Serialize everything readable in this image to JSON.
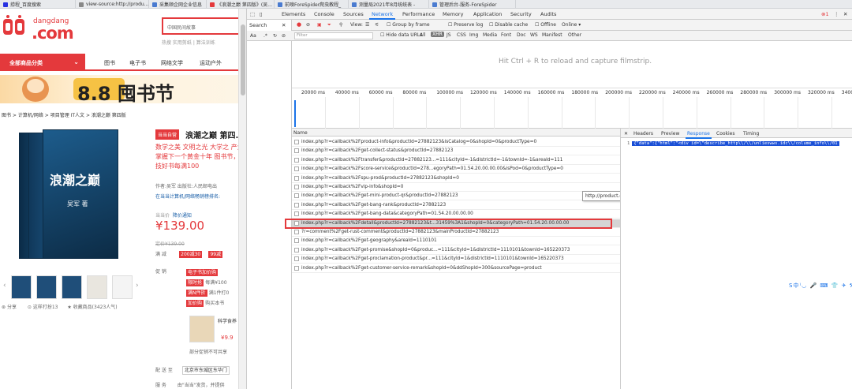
{
  "browser_tabs": [
    {
      "label": "捞程_百度搜索",
      "color": "#2932e1",
      "w": 96
    },
    {
      "label": "view-source:http://produ...",
      "color": "#888",
      "w": 93
    },
    {
      "label": "采集顺企网企业信息",
      "color": "#4a7bd0",
      "w": 73
    },
    {
      "label": "《浪潮之巅 第四版》(吴...",
      "color": "#e4393c",
      "w": 86
    },
    {
      "label": "前嗅ForeSpider爬虫教程_",
      "color": "#4a7bd0",
      "w": 94
    },
    {
      "label": "测量局2021年8月统统表 -",
      "color": "#4a7bd0",
      "w": 102
    },
    {
      "label": "管理后台-服务-ForeSpider",
      "color": "#4a7bd0",
      "w": 110
    }
  ],
  "page": {
    "logo_small": "dangdang",
    "logo_big": ".com",
    "search_value": "中国民间故事",
    "hot_words": "热搜  实用剪纸 | 算法训练",
    "all_categories": "全部商品分类",
    "nav": [
      "图书",
      "电子书",
      "网络文学",
      "运动户外"
    ],
    "banner_text": "8.8 囤书节",
    "breadcrumb": "图书 > 计算机/网络 > 项目管理 IT人文 > 浪潮之巅 第四版",
    "badge": "当当自营",
    "title": "浪潮之巅 第四...",
    "desc": "数学之美 文明之光 大学之 产业 掌握下一个黄金十年 图书节，科技好书每满100",
    "author_line1": "作者:吴军   出版社:人民邮电出",
    "author_line2": "在当当计算机/网络畅销榜排名:",
    "price_label": "当当价",
    "price_notice": "降价通知",
    "price": "¥139.00",
    "list_price": "定价¥139.00",
    "promo_label1": "满 减",
    "promo_tag1": "200减30",
    "promo_tag2": "99减",
    "promo_label2": "促 销",
    "promo_tags": [
      "电子书加价购",
      "限时抢",
      "满N件折",
      "加价购"
    ],
    "promo_texts": [
      "每满¥100",
      "满1件打0",
      "购买本书"
    ],
    "mini_book": "科学食养",
    "mini_price": "¥9.9",
    "not_support": "部分促销不可共享",
    "ship_to_label": "配 送 至",
    "ship_to": "北京市东城区东华门",
    "service_label": "服 务",
    "service": "由\"当当\"发货，并提供",
    "share": "分享",
    "bookmark": "收藏商品(3423人气)",
    "compare": "这样打扮13"
  },
  "devtools": {
    "tabs": [
      "Elements",
      "Console",
      "Sources",
      "Network",
      "Performance",
      "Memory",
      "Application",
      "Security",
      "Audits"
    ],
    "active_tab": "Network",
    "error_count": "1",
    "search_label": "Search",
    "toolbar": {
      "view": "View:",
      "group": "Group by frame",
      "preserve": "Preserve log",
      "disable_cache": "Disable cache",
      "offline": "Offline",
      "online": "Online"
    },
    "toolbar2": {
      "filter_placeholder": "Filter",
      "hide_data": "Hide data URLs",
      "types": [
        "All",
        "XHR",
        "JS",
        "CSS",
        "Img",
        "Media",
        "Font",
        "Doc",
        "WS",
        "Manifest",
        "Other"
      ]
    },
    "hint": "Hit Ctrl + R to reload and capture filmstrip.",
    "ruler_ticks": [
      "20000 ms",
      "40000 ms",
      "60000 ms",
      "80000 ms",
      "100000 ms",
      "120000 ms",
      "140000 ms",
      "160000 ms",
      "180000 ms",
      "200000 ms",
      "220000 ms",
      "240000 ms",
      "260000 ms",
      "280000 ms",
      "300000 ms",
      "320000 ms",
      "3400"
    ],
    "name_header": "Name",
    "requests": [
      "index.php?r=callback%2Fproduct-info&productId=27882123&isCatalog=0&shopId=0&productType=0",
      "index.php?r=callback%2Fget-collect-status&productId=27882123",
      "index.php?r=callback%2Ftransfer&productId=27882123...=111&cityId=-1&districtId=-1&townId=-1&areaId=111",
      "index.php?r=callback%2Fscore-service&productId=278...egoryPath=01.54.20.00.00.00&isPod=0&productType=0",
      "index.php?r=callback%2Fspu-prod&productId=27882123&shopId=0",
      "index.php?r=callback%2Fvip-info&shopId=0",
      "index.php?r=callback%2Fget-mini-product-qr&productId=27882123",
      "index.php?r=callback%2Fget-bang-rank&productId=27882123",
      "index.php?r=callback%2Fget-bang-data&categoryPath=01.54.20.00.00.00",
      "index.php?r=callback%2Fdetail&productId=27882123&t...31459%3A1&shopId=0&categoryPath=01.54.20.00.00.00",
      "?r=comment%2Fget-rust-comment&productId=27882123&mainProductId=27882123",
      "index.php?r=callback%2Fget-geography&areaId=1110101",
      "index.php?r=callback%2Fget-promise&shopId=0&produc...=111&cityId=1&districtId=1110101&townId=165220373",
      "index.php?r=callback%2Fget-proclamation-product&pr...=111&cityId=1&districtId=1110101&townId=165220373",
      "index.php?r=callback%2Fget-customer-service-remark&shopId=0&ddShopId=300&sourcePage=product"
    ],
    "selected_index": 9,
    "tooltip": "http://product.dangdang.com/index.php?r=callback%2Fvip-info&shopId=0",
    "detail_tabs": [
      "Headers",
      "Preview",
      "Response",
      "Cookies",
      "Timing"
    ],
    "detail_active": "Response",
    "response_line_no": "1",
    "response_text": "{\"data\":{\"html\":\"<div id=\\\"describe_http\\\\/\\\\/unlieswws.idc\\\\/colume_info\\\\/01",
    "ime_bar": "S中⁾◡ 🎤 ⌨ 👕 ✈ ⚒"
  },
  "colors": {
    "accent": "#e4393c",
    "devtools_blue": "#1a73e8"
  }
}
